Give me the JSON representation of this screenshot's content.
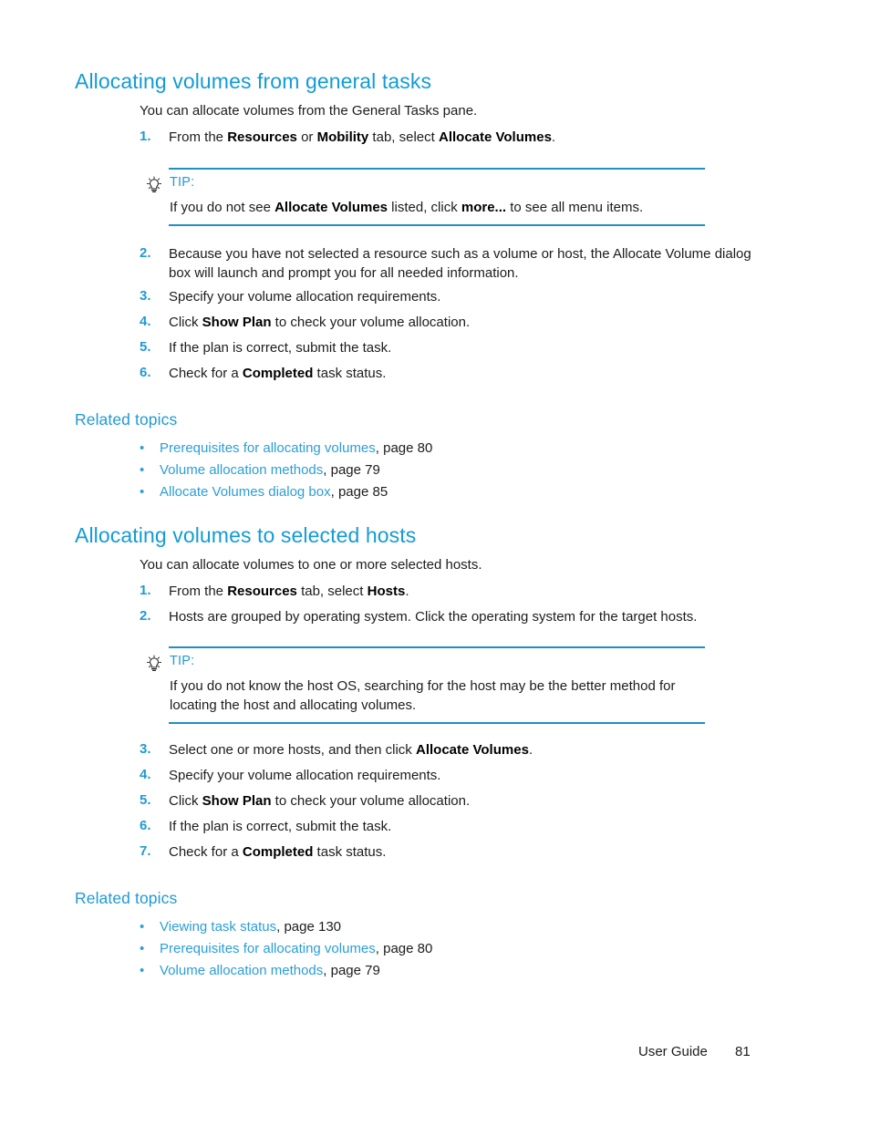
{
  "document": {
    "footer": {
      "guide_label": "User Guide",
      "page_number": "81"
    },
    "colors": {
      "heading_blue": "#149bd7",
      "subheading_blue": "#1f9ad6",
      "link_blue": "#2b9ed8",
      "rule_blue": "#1f8fc4",
      "body_text": "#1c1c1c"
    }
  },
  "sections": [
    {
      "title": "Allocating volumes from general tasks",
      "intro": "You can allocate volumes from the General Tasks pane.",
      "steps_before_tip": [
        {
          "number": "1.",
          "parts": [
            {
              "t": "From the ",
              "b": false
            },
            {
              "t": "Resources",
              "b": true
            },
            {
              "t": " or ",
              "b": false
            },
            {
              "t": "Mobility",
              "b": true
            },
            {
              "t": " tab, select ",
              "b": false
            },
            {
              "t": "Allocate Volumes",
              "b": true
            },
            {
              "t": ".",
              "b": false
            }
          ]
        }
      ],
      "tip": {
        "icon": "lightbulb-icon",
        "label": "TIP:",
        "parts": [
          {
            "t": "If you do not see ",
            "b": false
          },
          {
            "t": "Allocate Volumes",
            "b": true
          },
          {
            "t": " listed, click ",
            "b": false
          },
          {
            "t": "more...",
            "b": true
          },
          {
            "t": " to see all menu items.",
            "b": false
          }
        ]
      },
      "steps_after_tip": [
        {
          "number": "2.",
          "parts": [
            {
              "t": "Because you have not selected a resource such as a volume or host, the Allocate Volume dialog box will launch and prompt you for all needed information.",
              "b": false
            }
          ]
        },
        {
          "number": "3.",
          "parts": [
            {
              "t": "Specify your volume allocation requirements.",
              "b": false
            }
          ]
        },
        {
          "number": "4.",
          "parts": [
            {
              "t": "Click ",
              "b": false
            },
            {
              "t": "Show Plan",
              "b": true
            },
            {
              "t": " to check your volume allocation.",
              "b": false
            }
          ]
        },
        {
          "number": "5.",
          "parts": [
            {
              "t": "If the plan is correct, submit the task.",
              "b": false
            }
          ]
        },
        {
          "number": "6.",
          "parts": [
            {
              "t": "Check for a ",
              "b": false
            },
            {
              "t": "Completed",
              "b": true
            },
            {
              "t": " task status.",
              "b": false
            }
          ]
        }
      ],
      "related_title": "Related topics",
      "related_links": [
        {
          "bullet": "•",
          "link": "Prerequisites for allocating volumes",
          "page": ", page 80"
        },
        {
          "bullet": "•",
          "link": "Volume allocation methods",
          "page": ", page 79"
        },
        {
          "bullet": "•",
          "link": "Allocate Volumes dialog box",
          "page": ", page 85"
        }
      ]
    },
    {
      "title": "Allocating volumes to selected hosts",
      "intro": "You can allocate volumes to one or more selected hosts.",
      "steps_before_tip": [
        {
          "number": "1.",
          "parts": [
            {
              "t": "From the ",
              "b": false
            },
            {
              "t": "Resources",
              "b": true
            },
            {
              "t": " tab, select ",
              "b": false
            },
            {
              "t": "Hosts",
              "b": true
            },
            {
              "t": ".",
              "b": false
            }
          ]
        },
        {
          "number": "2.",
          "parts": [
            {
              "t": "Hosts are grouped by operating system. Click the operating system for the target hosts.",
              "b": false
            }
          ]
        }
      ],
      "tip": {
        "icon": "lightbulb-icon",
        "label": "TIP:",
        "parts": [
          {
            "t": "If you do not know the host OS, searching for the host may be the better method for locating the host and allocating volumes.",
            "b": false
          }
        ]
      },
      "steps_after_tip": [
        {
          "number": "3.",
          "parts": [
            {
              "t": "Select one or more hosts, and then click ",
              "b": false
            },
            {
              "t": "Allocate Volumes",
              "b": true
            },
            {
              "t": ".",
              "b": false
            }
          ]
        },
        {
          "number": "4.",
          "parts": [
            {
              "t": "Specify your volume allocation requirements.",
              "b": false
            }
          ]
        },
        {
          "number": "5.",
          "parts": [
            {
              "t": "Click ",
              "b": false
            },
            {
              "t": "Show Plan",
              "b": true
            },
            {
              "t": " to check your volume allocation.",
              "b": false
            }
          ]
        },
        {
          "number": "6.",
          "parts": [
            {
              "t": "If the plan is correct, submit the task.",
              "b": false
            }
          ]
        },
        {
          "number": "7.",
          "parts": [
            {
              "t": "Check for a ",
              "b": false
            },
            {
              "t": "Completed",
              "b": true
            },
            {
              "t": " task status.",
              "b": false
            }
          ]
        }
      ],
      "related_title": "Related topics",
      "related_links": [
        {
          "bullet": "•",
          "link": "Viewing task status",
          "page": ", page 130"
        },
        {
          "bullet": "•",
          "link": "Prerequisites for allocating volumes",
          "page": ", page 80"
        },
        {
          "bullet": "•",
          "link": "Volume allocation methods",
          "page": ", page 79"
        }
      ]
    }
  ]
}
